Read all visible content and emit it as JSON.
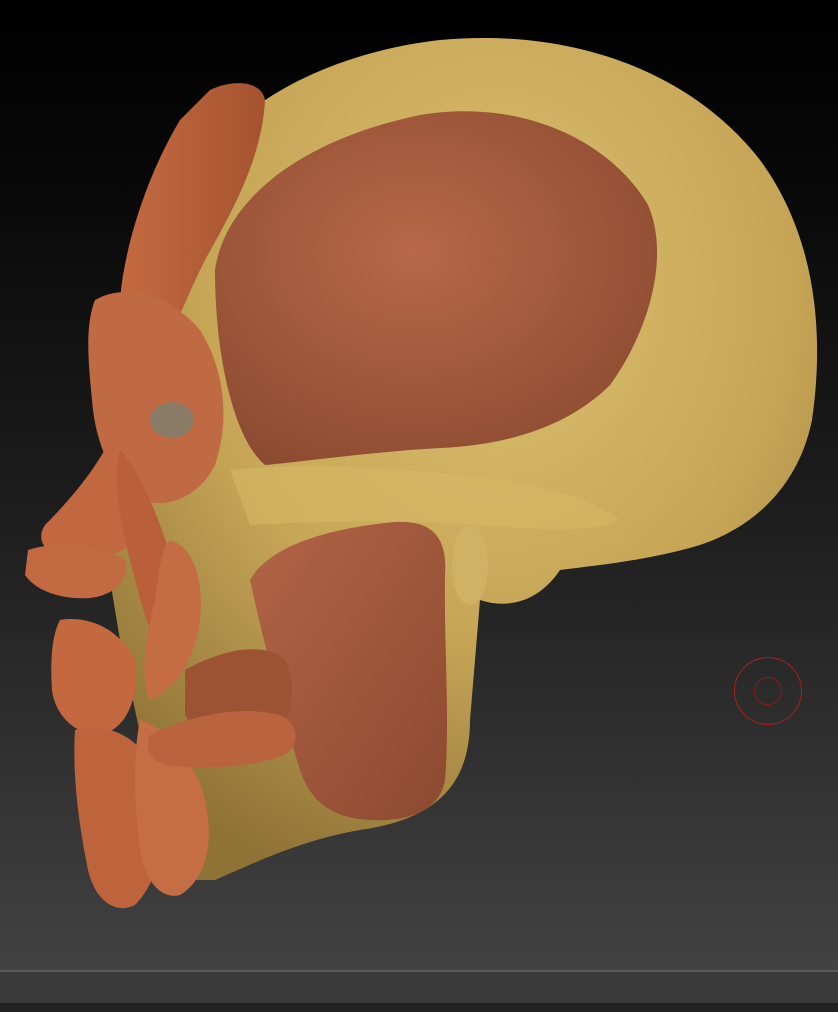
{
  "app": {
    "status_text": ""
  },
  "viewport": {
    "subject": "anatomical-skull-model-side-view",
    "colors": {
      "bone": "#c9a85a",
      "bone_light": "#d8bb6e",
      "bone_dark": "#9c7e3e",
      "muscle": "#a85c3c",
      "muscle_light": "#c06a43",
      "muscle_dark": "#7d3f26",
      "cursor": "#a82020"
    }
  },
  "brush_cursor": {
    "icon": "brush-cursor-icon"
  }
}
